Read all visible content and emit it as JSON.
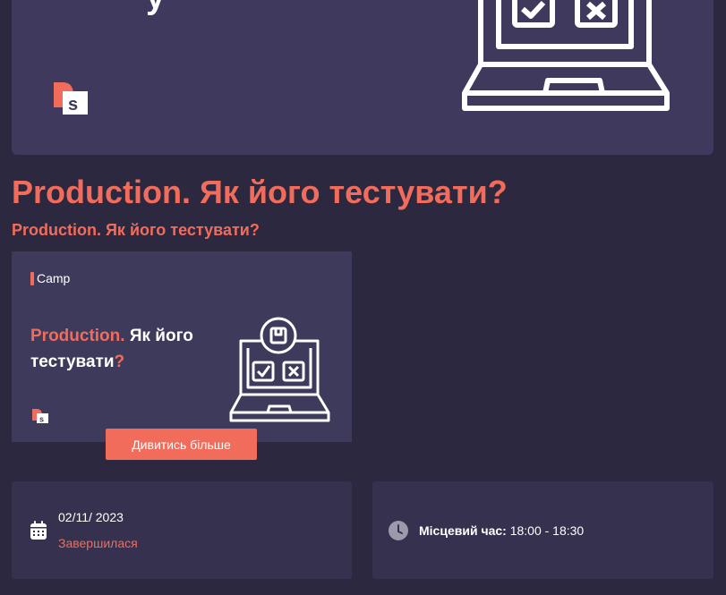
{
  "hero": {
    "partial_heading": "y"
  },
  "event": {
    "title": "Production. Як його тестувати?",
    "subtitle": "Production. Як його тестувати?"
  },
  "banner": {
    "brand": "Camp",
    "title_accent": "Production.",
    "title_rest": " Як його тестувати",
    "title_mark": "?"
  },
  "actions": {
    "more_label": "Дивитись більше"
  },
  "details": {
    "date": "02/11/ 2023",
    "status": "Завершилася",
    "time_label": "Місцевий час:",
    "time_value": " 18:00 - 18:30"
  },
  "colors": {
    "accent": "#f26c5b",
    "background": "#2b2840",
    "card": "#35314e",
    "banner": "#3e3a5c"
  },
  "icons": [
    "logo-icon",
    "laptop-icon",
    "calendar-icon",
    "clock-icon"
  ]
}
